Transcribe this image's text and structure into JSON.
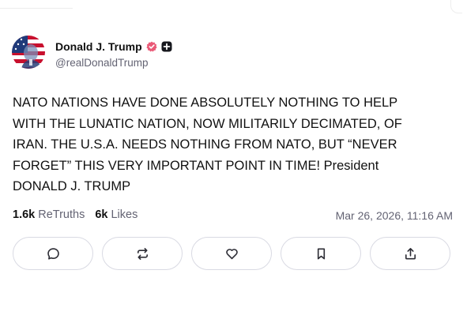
{
  "author": {
    "display_name": "Donald J. Trump",
    "handle": "@realDonaldTrump",
    "verified": true,
    "badges": [
      "verified-icon",
      "plus-icon"
    ],
    "verified_color": "#ea5a77"
  },
  "post": {
    "text": "NATO NATIONS HAVE DONE ABSOLUTELY NOTHING TO HELP\nWITH THE LUNATIC NATION, NOW MILITARILY DECIMATED, OF\nIRAN. THE U.S.A. NEEDS NOTHING FROM NATO, BUT “NEVER\nFORGET” THIS VERY IMPORTANT POINT IN TIME! President\nDONALD J. TRUMP"
  },
  "stats": {
    "retruths_count": "1.6k",
    "retruths_label": "ReTruths",
    "likes_count": "6k",
    "likes_label": "Likes"
  },
  "timestamp": "Mar 26, 2026, 11:16 AM",
  "actions": [
    {
      "icon": "reply-icon"
    },
    {
      "icon": "retruth-icon"
    },
    {
      "icon": "like-icon"
    },
    {
      "icon": "bookmark-icon"
    },
    {
      "icon": "share-icon"
    }
  ],
  "colors": {
    "text": "#111111",
    "muted": "#636373",
    "border": "#d9dae3"
  }
}
